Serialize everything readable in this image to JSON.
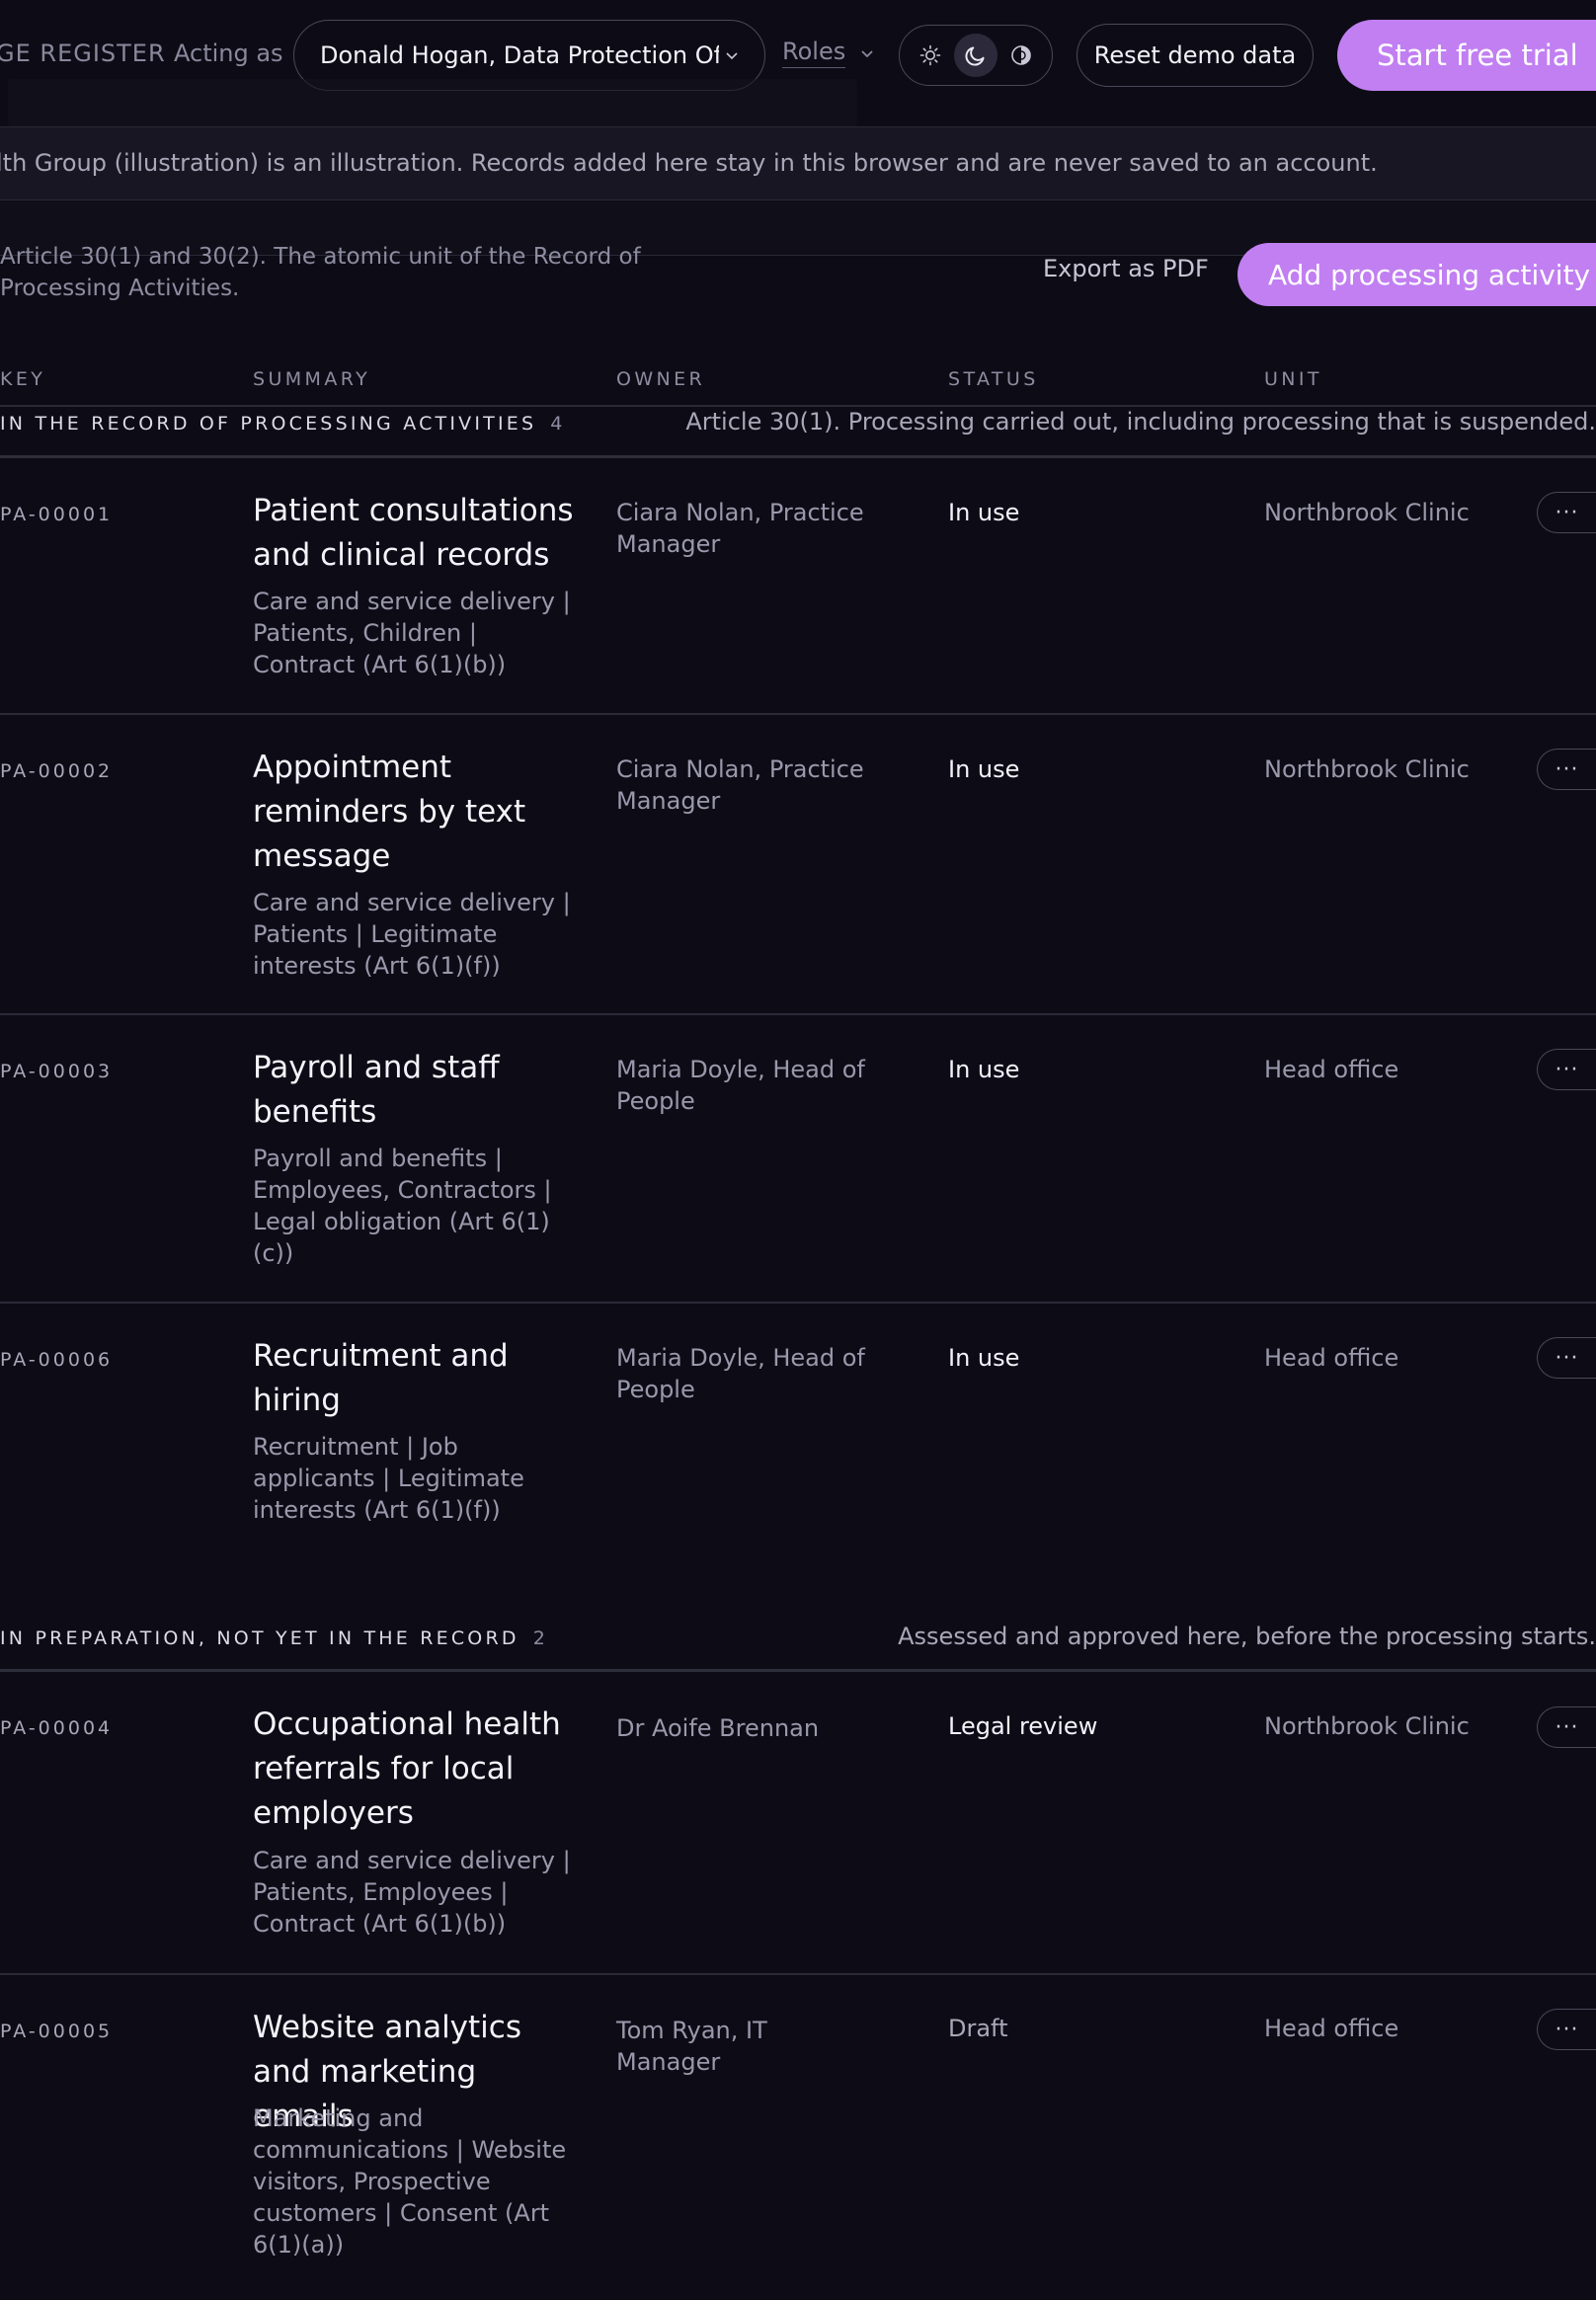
{
  "topbar": {
    "brand": "GE REGISTER",
    "acting_label": "Acting as",
    "acting_value": "Donald Hogan, Data Protection Officer",
    "roles_label": "Roles",
    "reset_label": "Reset demo data",
    "trial_label": "Start free trial"
  },
  "banner": {
    "text": "lth Group (illustration) is an illustration. Records added here stay in this browser and are never saved to an account."
  },
  "page": {
    "description": "Article 30(1) and 30(2). The atomic unit of the Record of Processing Activities.",
    "export_label": "Export as PDF",
    "add_label": "Add processing activity"
  },
  "table": {
    "headers": {
      "key": "KEY",
      "summary": "SUMMARY",
      "owner": "OWNER",
      "status": "STATUS",
      "unit": "UNIT"
    }
  },
  "groups": [
    {
      "title": "IN THE RECORD OF PROCESSING ACTIVITIES",
      "count": "4",
      "note": "Article 30(1). Processing carried out, including processing that is suspended.",
      "rows": [
        {
          "key": "PA-00001",
          "title": "Patient consultations and clinical records",
          "sub": "Care and service delivery | Patients, Children | Contract (Art 6(1)(b))",
          "owner": "Ciara Nolan, Practice Manager",
          "status": "In use",
          "unit": "Northbrook Clinic"
        },
        {
          "key": "PA-00002",
          "title": "Appointment reminders by text message",
          "sub": "Care and service delivery | Patients | Legitimate interests (Art 6(1)(f))",
          "owner": "Ciara Nolan, Practice Manager",
          "status": "In use",
          "unit": "Northbrook Clinic"
        },
        {
          "key": "PA-00003",
          "title": "Payroll and staff benefits",
          "sub": "Payroll and benefits | Employees, Contractors | Legal obligation (Art 6(1)(c))",
          "owner": "Maria Doyle, Head of People",
          "status": "In use",
          "unit": "Head office"
        },
        {
          "key": "PA-00006",
          "title": "Recruitment and hiring",
          "sub": "Recruitment | Job applicants | Legitimate interests (Art 6(1)(f))",
          "owner": "Maria Doyle, Head of People",
          "status": "In use",
          "unit": "Head office"
        }
      ]
    },
    {
      "title": "IN PREPARATION, NOT YET IN THE RECORD",
      "count": "2",
      "note": "Assessed and approved here, before the processing starts.",
      "rows": [
        {
          "key": "PA-00004",
          "title": "Occupational health referrals for local employers",
          "sub": "Care and service delivery | Patients, Employees | Contract (Art 6(1)(b))",
          "owner": "Dr Aoife Brennan",
          "status": "Legal review",
          "unit": "Northbrook Clinic"
        },
        {
          "key": "PA-00005",
          "title": "Website analytics and marketing emails",
          "sub": "Marketing and communications | Website visitors, Prospective customers | Consent (Art 6(1)(a))",
          "owner": "Tom Ryan, IT Manager",
          "status": "Draft",
          "unit": "Head office"
        }
      ]
    }
  ],
  "more_label": "···",
  "colors": {
    "accent": "#c17ff2",
    "background": "#0d0c16",
    "border": "#4a4858"
  },
  "icons": [
    "sun-icon",
    "moon-icon",
    "contrast-icon",
    "chevron-down-icon"
  ]
}
